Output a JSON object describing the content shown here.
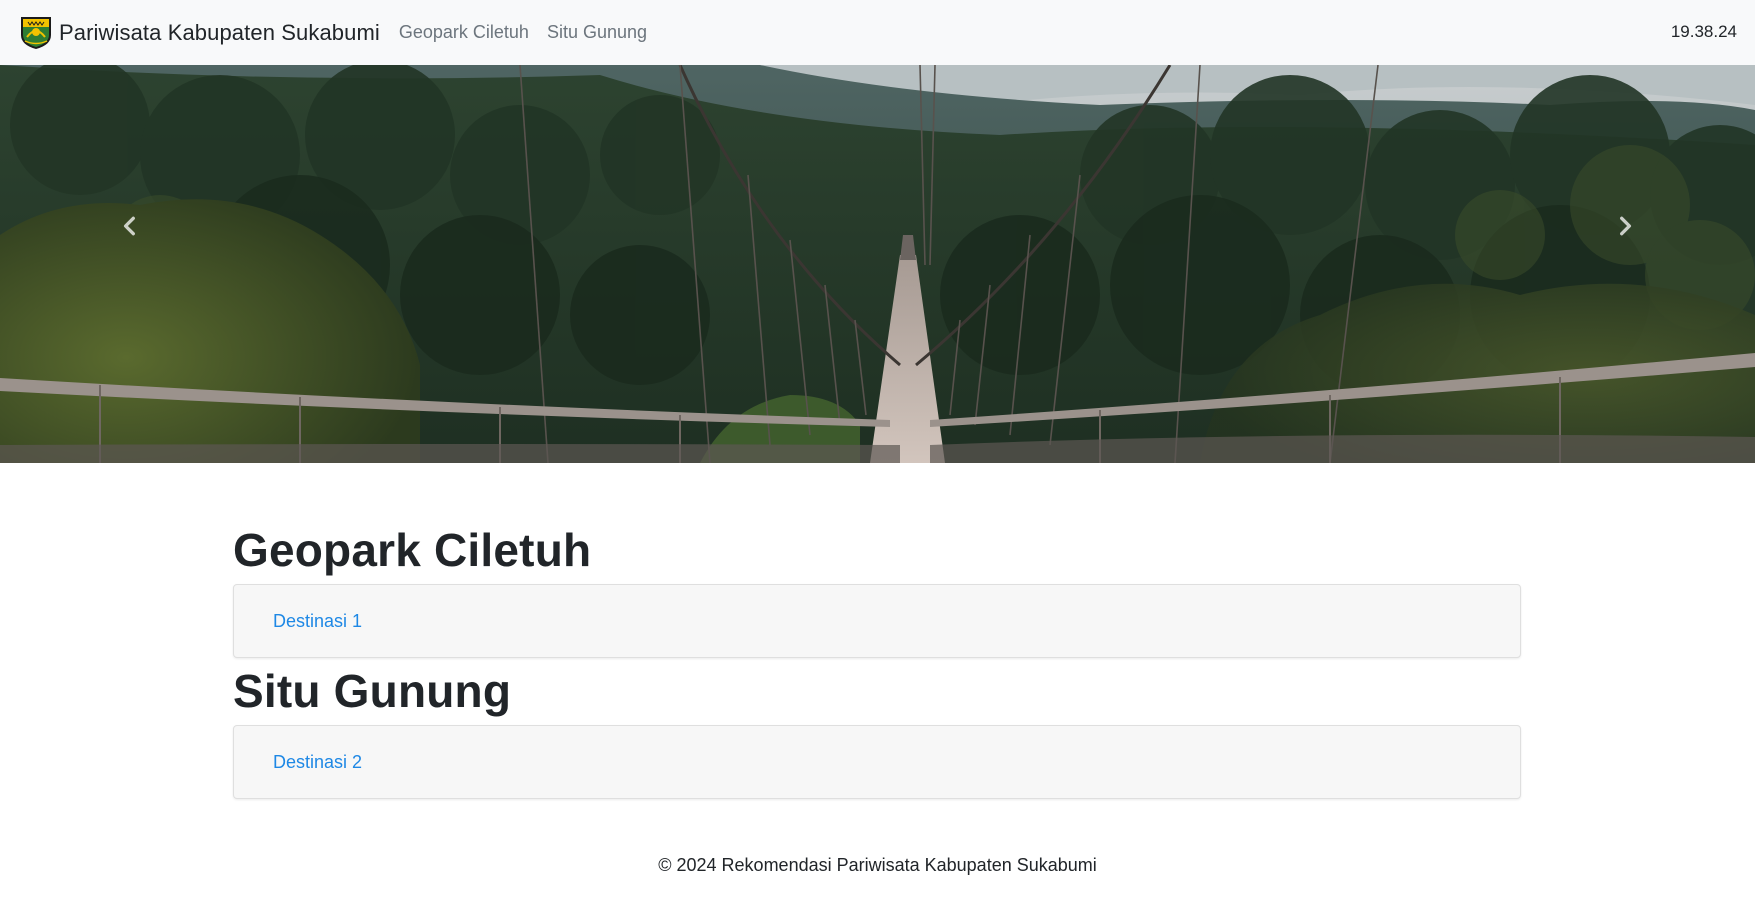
{
  "navbar": {
    "brand": "Pariwisata Kabupaten Sukabumi",
    "links": [
      "Geopark Ciletuh",
      "Situ Gunung"
    ],
    "clock": "19.38.24",
    "logo_icon": "sukabumi-crest-icon"
  },
  "carousel": {
    "prev_icon": "chevron-left-icon",
    "next_icon": "chevron-right-icon"
  },
  "sections": [
    {
      "title": "Geopark Ciletuh",
      "destination": "Destinasi 1"
    },
    {
      "title": "Situ Gunung",
      "destination": "Destinasi 2"
    }
  ],
  "footer": {
    "text": "© 2024 Rekomendasi Pariwisata Kabupaten Sukabumi"
  },
  "colors": {
    "navbar_bg": "#f8f9fa",
    "link": "#1e88e5",
    "card_bg": "#f7f7f7"
  }
}
